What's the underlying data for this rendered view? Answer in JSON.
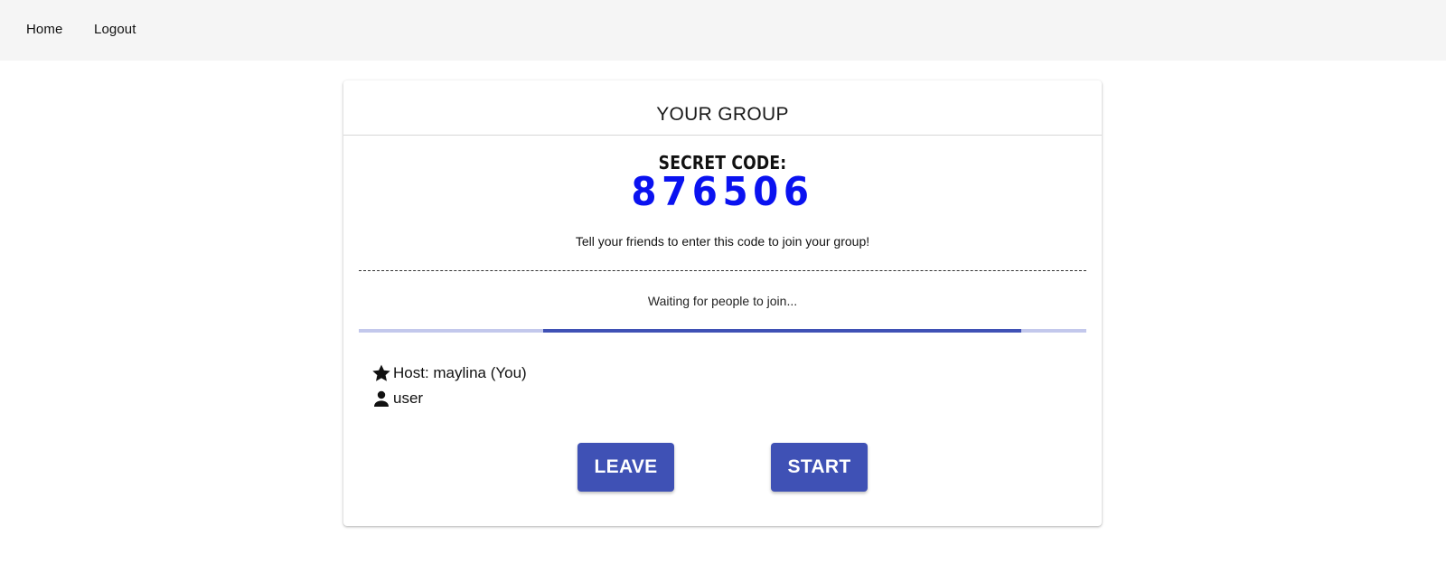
{
  "nav": {
    "home": "Home",
    "logout": "Logout"
  },
  "group": {
    "title": "YOUR GROUP",
    "secret_label": "SECRET CODE:",
    "secret_code": "876506",
    "hint": "Tell your friends to enter this code to join your group!",
    "waiting": "Waiting for people to join...",
    "members": [
      {
        "label": "Host: maylina (You)",
        "icon": "star-icon"
      },
      {
        "label": "user",
        "icon": "person-icon"
      }
    ],
    "leave_label": "LEAVE",
    "start_label": "START"
  },
  "colors": {
    "accent": "#3f51b5",
    "code": "#0a12f0",
    "progress_track": "#c3c8ec",
    "topbar": "#f5f5f5"
  }
}
